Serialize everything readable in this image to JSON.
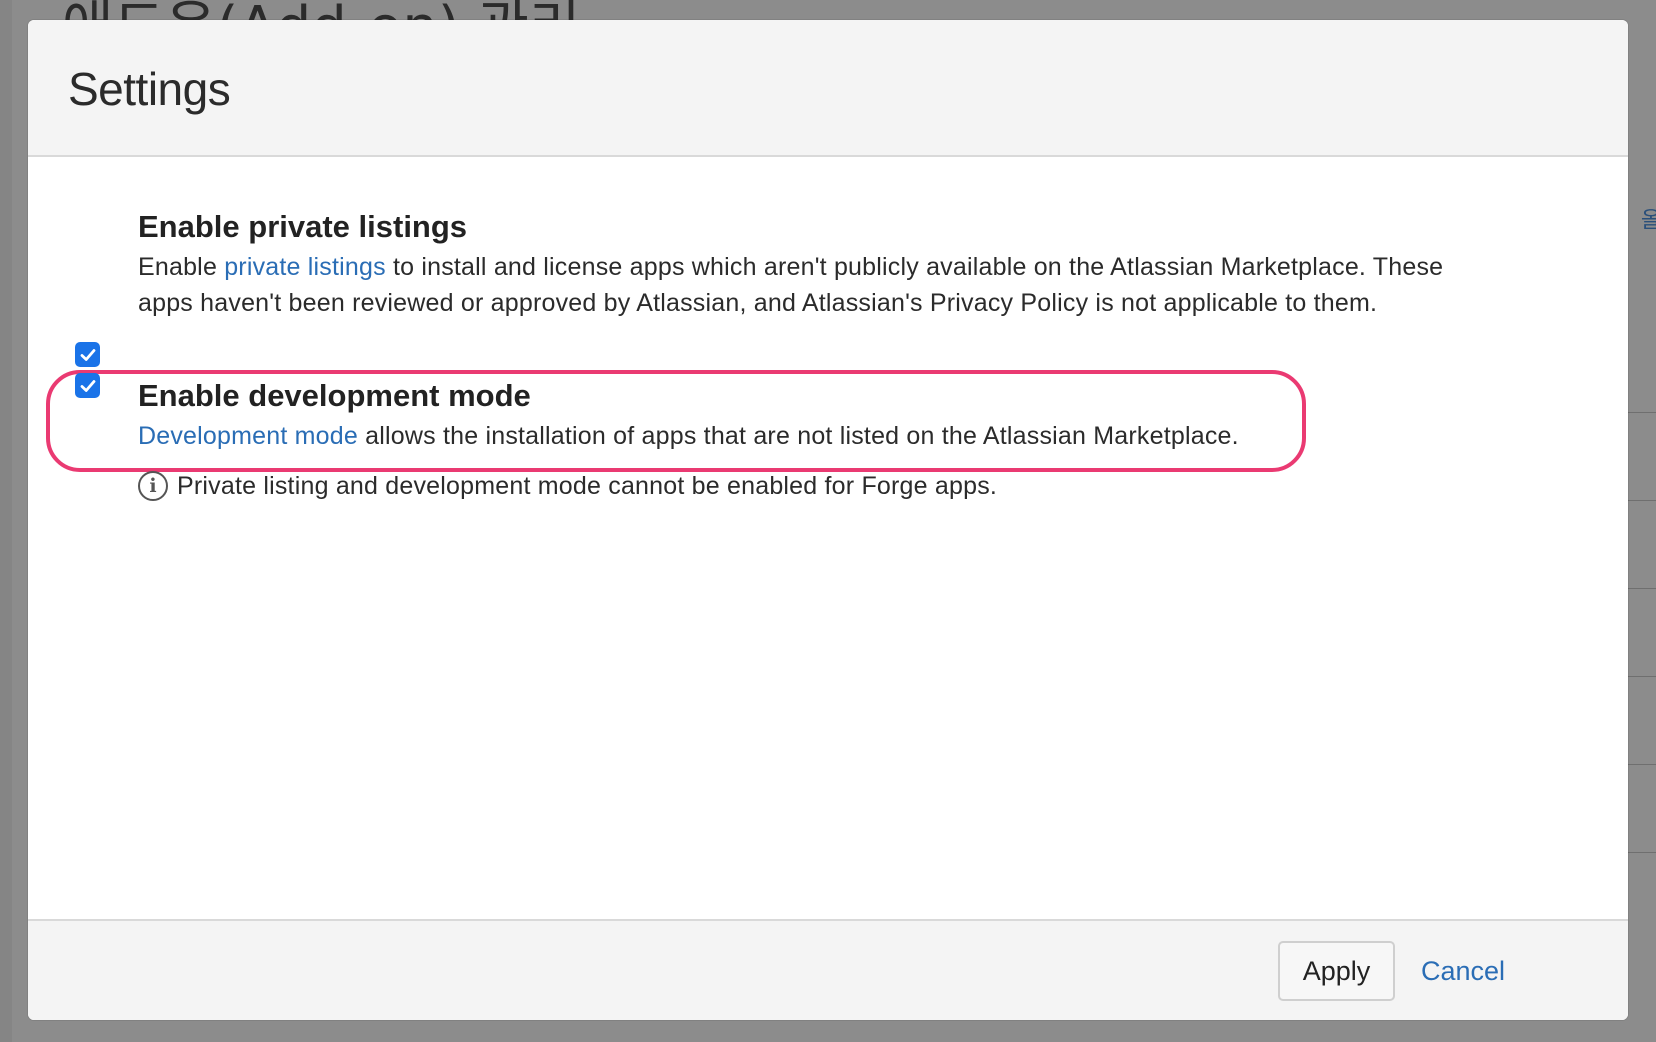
{
  "background": {
    "page_title": "애드온(Add-on) 관리",
    "side_text": "올"
  },
  "dialog": {
    "title": "Settings",
    "options": [
      {
        "title": "Enable private listings",
        "checked": true,
        "desc_prefix": "Enable ",
        "desc_link": "private listings",
        "desc_suffix": " to install and license apps which aren't publicly available on the Atlassian Marketplace. These apps haven't been reviewed or approved by Atlassian, and Atlassian's Privacy Policy is not applicable to them."
      },
      {
        "title": "Enable development mode",
        "checked": true,
        "desc_prefix": "",
        "desc_link": "Development mode",
        "desc_suffix": " allows the installation of apps that are not listed on the Atlassian Marketplace."
      }
    ],
    "info_icon": "info-icon",
    "info_text": "Private listing and development mode cannot be enabled for Forge apps.",
    "apply_label": "Apply",
    "cancel_label": "Cancel"
  },
  "colors": {
    "checkbox": "#1a73e8",
    "link": "#2a6db5",
    "highlight": "#ea3a72",
    "overlay": "#8c8c8c"
  }
}
